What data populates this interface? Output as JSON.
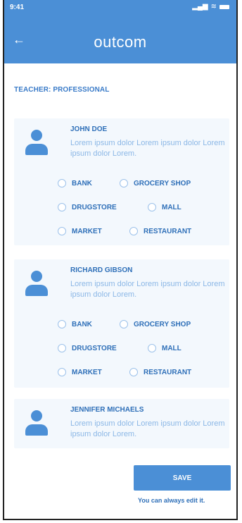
{
  "status_bar": {
    "time": "9:41",
    "signal": "▂▄▆",
    "wifi": "≋"
  },
  "header": {
    "back_icon": "←",
    "title": "outcom"
  },
  "section_label": "TEACHER: PROFESSIONAL",
  "students": [
    {
      "name": "JOHN DOE",
      "description": "Lorem ipsum dolor Lorem ipsum dolor Lorem ipsum dolor Lorem.",
      "options": [
        "BANK",
        "GROCERY SHOP",
        "DRUGSTORE",
        "MALL",
        "MARKET",
        "RESTAURANT"
      ]
    },
    {
      "name": "RICHARD GIBSON",
      "description": "Lorem ipsum dolor Lorem ipsum dolor Lorem ipsum dolor Lorem.",
      "options": [
        "BANK",
        "GROCERY SHOP",
        "DRUGSTORE",
        "MALL",
        "MARKET",
        "RESTAURANT"
      ]
    },
    {
      "name": "JENNIFER MICHAELS",
      "description": "Lorem ipsum dolor Lorem ipsum dolor Lorem ipsum dolor Lorem.",
      "options": []
    }
  ],
  "save_button": "SAVE",
  "hint": "You can always edit it.",
  "colors": {
    "primary": "#4b8fd6",
    "card_bg": "#f3f8fd",
    "text_blue": "#2e6fb8",
    "muted_blue": "#8bb7e6"
  }
}
